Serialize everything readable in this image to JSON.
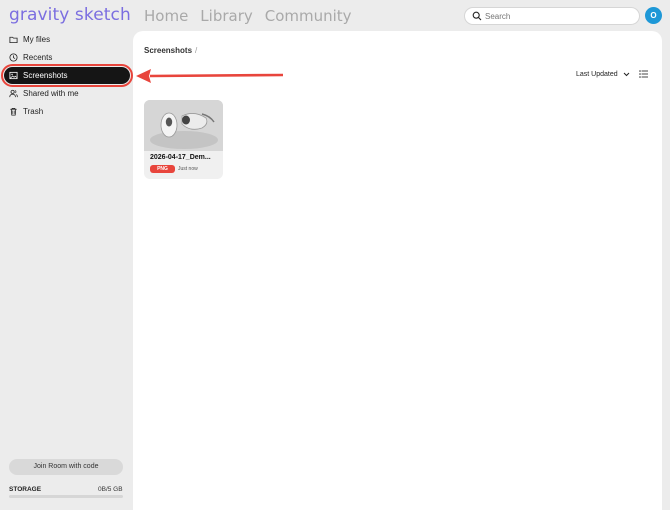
{
  "header": {
    "logo": "gravity sketch",
    "nav": [
      "Home",
      "Library",
      "Community"
    ],
    "search_placeholder": "Search",
    "avatar_initial": "O"
  },
  "sidebar": {
    "items": [
      {
        "label": "My files",
        "icon": "folder-icon"
      },
      {
        "label": "Recents",
        "icon": "clock-icon"
      },
      {
        "label": "Screenshots",
        "icon": "image-icon",
        "active": true
      },
      {
        "label": "Shared with me",
        "icon": "users-icon"
      },
      {
        "label": "Trash",
        "icon": "trash-icon"
      }
    ],
    "join_room_label": "Join Room with code",
    "storage_label": "STORAGE",
    "storage_value": "0B/5 GB",
    "storage_used_fraction": 0.0
  },
  "main": {
    "breadcrumb": "Screenshots",
    "breadcrumb_sep": "/",
    "sort_label": "Last Updated",
    "files": [
      {
        "title": "2026-04-17_Dem...",
        "type": "PNG",
        "updated": "Just now"
      }
    ]
  },
  "colors": {
    "accent_logo": "#7b6ee0",
    "highlight_red": "#e8453c",
    "avatar_blue": "#1e98d7"
  }
}
